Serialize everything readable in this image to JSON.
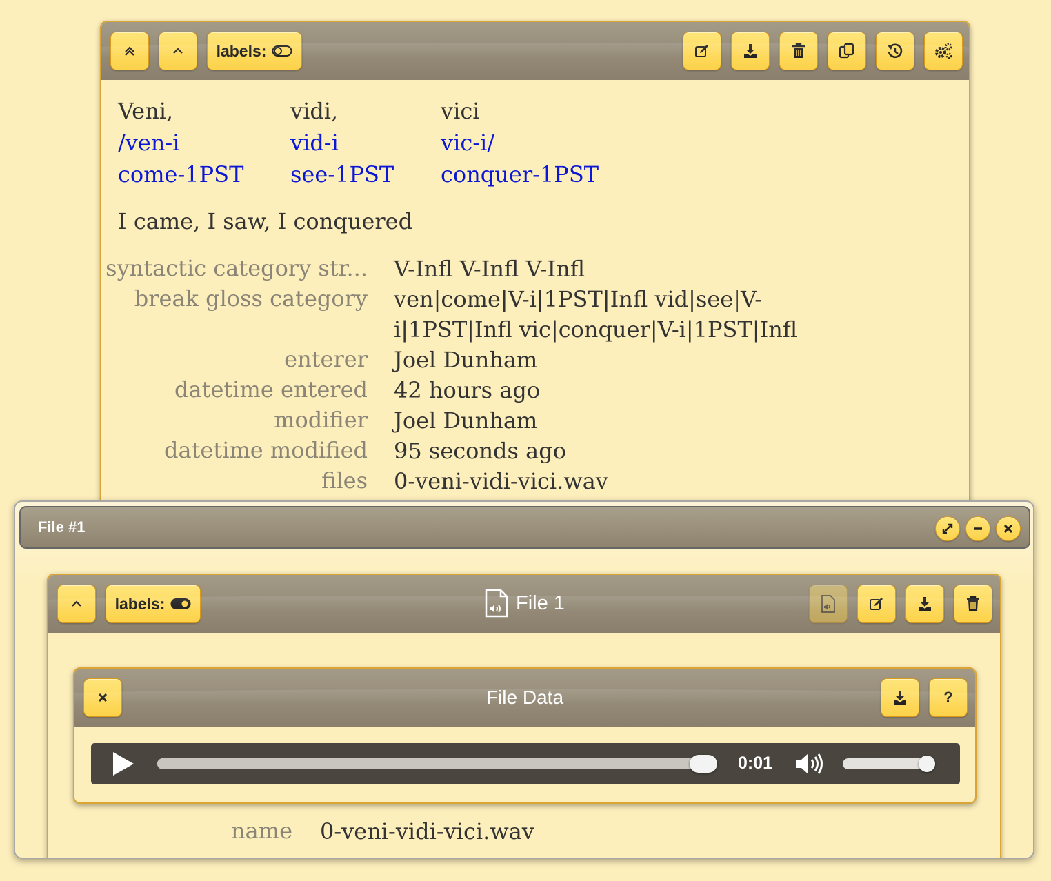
{
  "form": {
    "toolbar": {
      "labels_text": "labels:"
    },
    "igt": [
      {
        "transcription": "Veni,",
        "morpheme_break": "/ven-i",
        "morpheme_gloss": "come-1PST"
      },
      {
        "transcription": "vidi,",
        "morpheme_break": "vid-i",
        "morpheme_gloss": "see-1PST"
      },
      {
        "transcription": "vici",
        "morpheme_break": "vic-i/",
        "morpheme_gloss": "conquer-1PST"
      }
    ],
    "translation": "I came, I saw, I conquered",
    "fields": [
      {
        "label": "syntactic category str...",
        "value": "V-Infl V-Infl V-Infl"
      },
      {
        "label": "break gloss category",
        "value": "ven|come|V-i|1PST|Infl vid|see|V-i|1PST|Infl vic|conquer|V-i|1PST|Infl"
      },
      {
        "label": "enterer",
        "value": "Joel Dunham"
      },
      {
        "label": "datetime entered",
        "value": "42 hours ago"
      },
      {
        "label": "modifier",
        "value": "Joel Dunham"
      },
      {
        "label": "datetime modified",
        "value": "95 seconds ago"
      },
      {
        "label": "files",
        "value": "0-veni-vidi-vici.wav"
      }
    ]
  },
  "file_dialog": {
    "title": "File #1"
  },
  "file_widget": {
    "labels_text": "labels:",
    "title": "File 1"
  },
  "file_data": {
    "title": "File Data",
    "help_label": "?",
    "player": {
      "time": "0:01",
      "progress": 1.0,
      "volume": 1.0
    }
  },
  "file_fields": [
    {
      "label": "name",
      "value": "0-veni-vidi-vici.wav"
    }
  ],
  "colors": {
    "background": "#fdefbc",
    "button": "#fdd24a",
    "bar": "#958b77",
    "gloss_blue": "#0a17d6",
    "label_gray": "#8a8577"
  }
}
